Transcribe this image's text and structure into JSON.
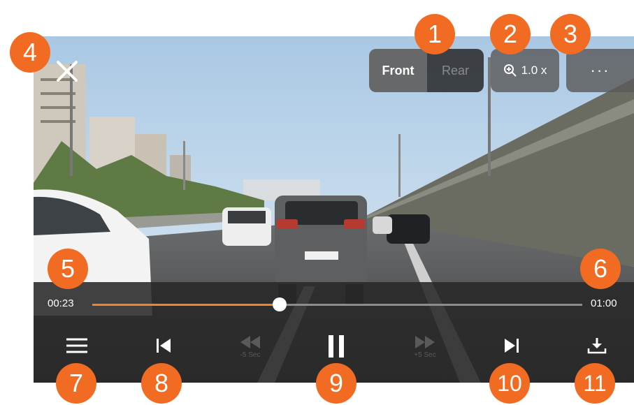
{
  "camera": {
    "front_label": "Front",
    "rear_label": "Rear"
  },
  "zoom": {
    "value_label": "1.0 x"
  },
  "more": {
    "label": "···"
  },
  "playback": {
    "current_time": "00:23",
    "total_time": "01:00",
    "progress": 0.383
  },
  "controls": {
    "rewind_label": "-5 Sec",
    "forward_label": "+5 Sec"
  },
  "callouts": [
    "1",
    "2",
    "3",
    "4",
    "5",
    "6",
    "7",
    "8",
    "9",
    "10",
    "11"
  ],
  "colors": {
    "accent": "#f26b22",
    "progress": "#f58220",
    "panel": "#282828"
  },
  "icons": [
    "close-icon",
    "zoom-in-icon",
    "more-icon",
    "playlist-icon",
    "skip-previous-icon",
    "rewind-icon",
    "pause-icon",
    "fast-forward-icon",
    "skip-next-icon",
    "download-icon"
  ]
}
